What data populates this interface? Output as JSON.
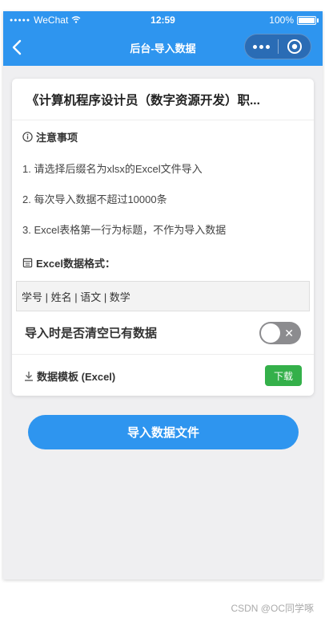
{
  "status_bar": {
    "carrier": "WeChat",
    "time": "12:59",
    "battery": "100%"
  },
  "nav": {
    "title": "后台-导入数据"
  },
  "card": {
    "title": "《计算机程序设计员（数字资源开发）职...",
    "notice_title": "注意事项",
    "tips": [
      "1. 请选择后缀名为xlsx的Excel文件导入",
      "2. 每次导入数据不超过10000条",
      "3. Excel表格第一行为标题，不作为导入数据"
    ],
    "format_title": "Excel数据格式：",
    "format_columns": "学号 | 姓名 | 语文 | 数学",
    "toggle_label": "导入时是否清空已有数据",
    "toggle_on": false,
    "template_label": "数据模板 (Excel)",
    "download_label": "下载"
  },
  "import_button": "导入数据文件",
  "watermark": "CSDN @OC同学啄",
  "colors": {
    "primary": "#2e95ef",
    "download": "#34b04a",
    "switch_off": "#8c8c8f"
  }
}
